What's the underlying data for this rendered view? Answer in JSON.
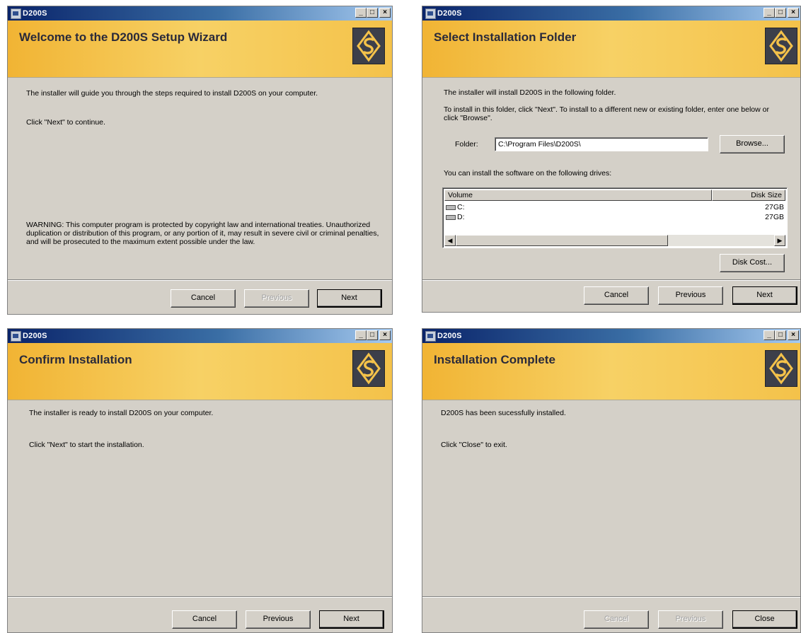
{
  "app_title": "D200S",
  "window_controls": {
    "minimize": "_",
    "maximize": "□",
    "close": "×"
  },
  "colors": {
    "titlebar": "#0a246a",
    "banner": "#f4c24a",
    "logo_bg": "#3c3f4a",
    "dialog_bg": "#d4d0c8"
  },
  "icons": {
    "app": "installer-icon",
    "logo": "d200s-logo-icon",
    "drive": "disk-drive-icon"
  },
  "welcome": {
    "heading": "Welcome to the D200S Setup Wizard",
    "line1": "The installer will guide you through the steps required to install D200S on your computer.",
    "line2": "Click \"Next\" to continue.",
    "warning": "WARNING: This computer program is protected by copyright law and international treaties. Unauthorized duplication or distribution of this program, or any portion of it, may result in severe civil or criminal penalties, and will be prosecuted to the maximum extent possible under the law.",
    "buttons": {
      "cancel": "Cancel",
      "previous": "Previous",
      "next": "Next"
    }
  },
  "folder": {
    "heading": "Select Installation Folder",
    "line1": "The installer will install D200S in the following folder.",
    "line2": "To install in this folder, click \"Next\". To install to a different new or existing folder, enter one below or click \"Browse\".",
    "folder_label": "Folder:",
    "folder_value": "C:\\Program Files\\D200S\\",
    "browse": "Browse...",
    "drives_label": "You can install the software on the following drives:",
    "columns": {
      "volume": "Volume",
      "disk_size": "Disk Size"
    },
    "drives": [
      {
        "volume": "C:",
        "size": "27GB"
      },
      {
        "volume": "D:",
        "size": "27GB"
      }
    ],
    "disk_cost": "Disk Cost...",
    "buttons": {
      "cancel": "Cancel",
      "previous": "Previous",
      "next": "Next"
    }
  },
  "confirm": {
    "heading": "Confirm Installation",
    "line1": "The installer is ready to install D200S on your computer.",
    "line2": "Click \"Next\" to start the installation.",
    "buttons": {
      "cancel": "Cancel",
      "previous": "Previous",
      "next": "Next"
    }
  },
  "complete": {
    "heading": "Installation Complete",
    "line1": "D200S has been sucessfully installed.",
    "line2": "Click \"Close\" to exit.",
    "buttons": {
      "cancel": "Cancel",
      "previous": "Previous",
      "close": "Close"
    }
  }
}
